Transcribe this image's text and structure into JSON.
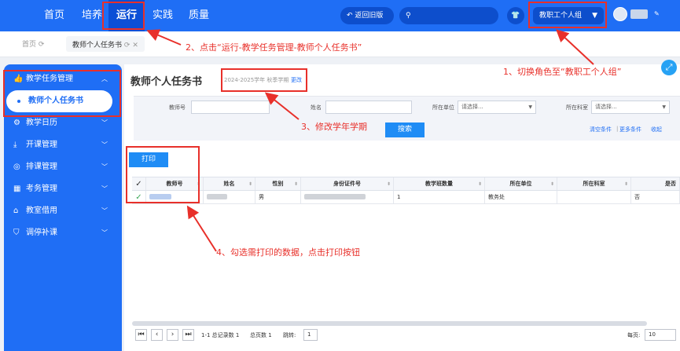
{
  "header": {
    "nav": [
      "首页",
      "培养",
      "运行",
      "实践",
      "质量"
    ],
    "back_label": "返回旧版",
    "search_placeholder": "",
    "role": "教职工个人组"
  },
  "tabs": {
    "home": "首页",
    "current": "教师个人任务书"
  },
  "sidebar": {
    "items": [
      {
        "label": "教学任务管理",
        "icon": "thumb-icon"
      },
      {
        "label": "教学日历",
        "icon": "gear-icon"
      },
      {
        "label": "开课管理",
        "icon": "download-icon"
      },
      {
        "label": "排课管理",
        "icon": "target-icon"
      },
      {
        "label": "考务管理",
        "icon": "grid-icon"
      },
      {
        "label": "教室借用",
        "icon": "home-icon"
      },
      {
        "label": "调停补课",
        "icon": "shield-icon"
      }
    ],
    "sub_item": "教师个人任务书"
  },
  "page": {
    "title": "教师个人任务书",
    "term": "2024-2025学年 秋季学期",
    "change_label": "更改"
  },
  "search": {
    "teacher_no_label": "教师号",
    "name_label": "姓名",
    "unit_label": "所在单位",
    "unit_value": "请选择...",
    "office_label": "所在科室",
    "office_value": "请选择...",
    "search_button": "搜索",
    "clear_label": "清空条件",
    "more_label": "更多条件",
    "collapse_label": "收起"
  },
  "toolbar": {
    "print_button": "打印"
  },
  "table": {
    "columns": [
      "教师号",
      "姓名",
      "性别",
      "身份证件号",
      "教学班数量",
      "所在单位",
      "所在科室",
      "是否"
    ],
    "rows": [
      {
        "gender": "男",
        "class_count": "1",
        "unit": "教务处",
        "office": "",
        "flag": "否"
      }
    ]
  },
  "pager": {
    "record_info": "1-1 总记录数 1",
    "page_info": "总页数 1",
    "jump_label": "跳转:",
    "jump_value": "1",
    "per_page_label": "每页:",
    "per_page_value": "10"
  },
  "annotations": {
    "step1": "1、切换角色至“教职工个人组”",
    "step2": "2、点击“运行-教学任务管理-教师个人任务书”",
    "step3": "3、修改学年学期",
    "step4": "4、勾选需打印的数据，点击打印按钮"
  },
  "colors": {
    "primary": "#1f6ef5",
    "annotation": "#e8302a"
  }
}
